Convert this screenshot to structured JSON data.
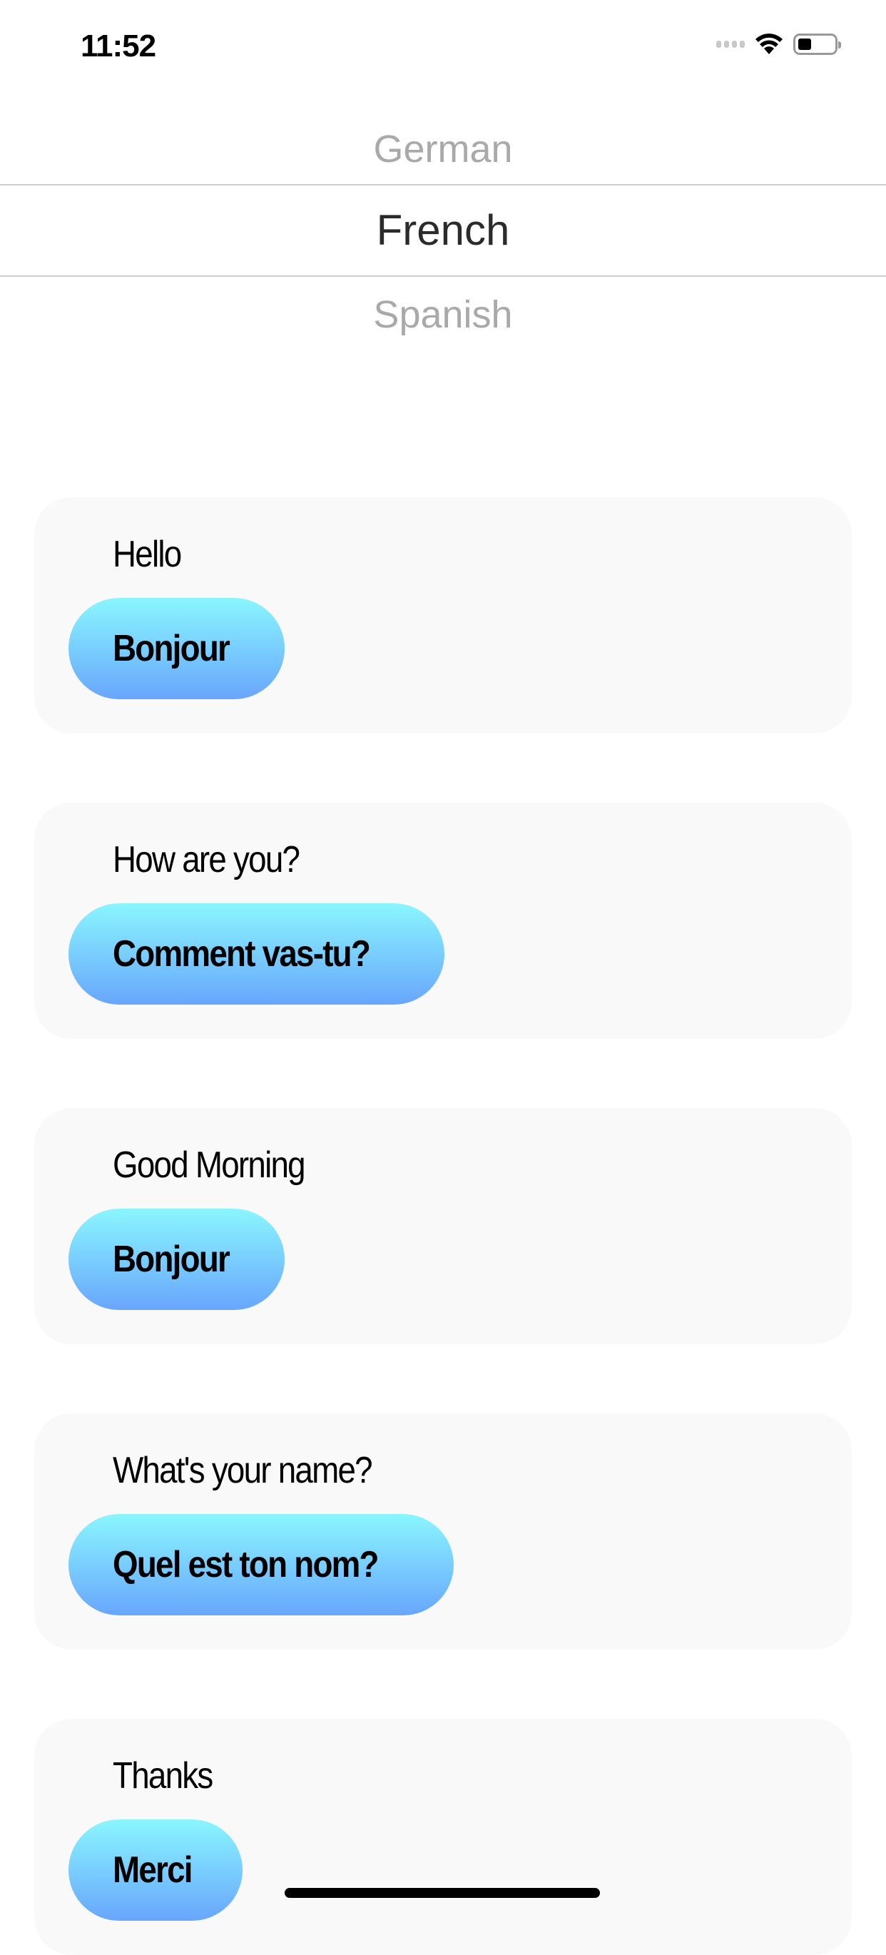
{
  "status_bar": {
    "time": "11:52",
    "icons": [
      "signal-icon",
      "wifi-icon",
      "battery-icon"
    ]
  },
  "picker": {
    "items": [
      "German",
      "French",
      "Spanish"
    ],
    "selected": "French"
  },
  "phrases": [
    {
      "english": "Hello",
      "translation": "Bonjour"
    },
    {
      "english": "How are you?",
      "translation": "Comment vas-tu?"
    },
    {
      "english": "Good Morning",
      "translation": "Bonjour"
    },
    {
      "english": "What's your name?",
      "translation": "Quel est ton nom?"
    },
    {
      "english": "Thanks",
      "translation": "Merci"
    }
  ],
  "colors": {
    "button_top": "#8af6fe",
    "button_bottom": "#68a6fd",
    "card_bg": "#f9f9f9"
  }
}
